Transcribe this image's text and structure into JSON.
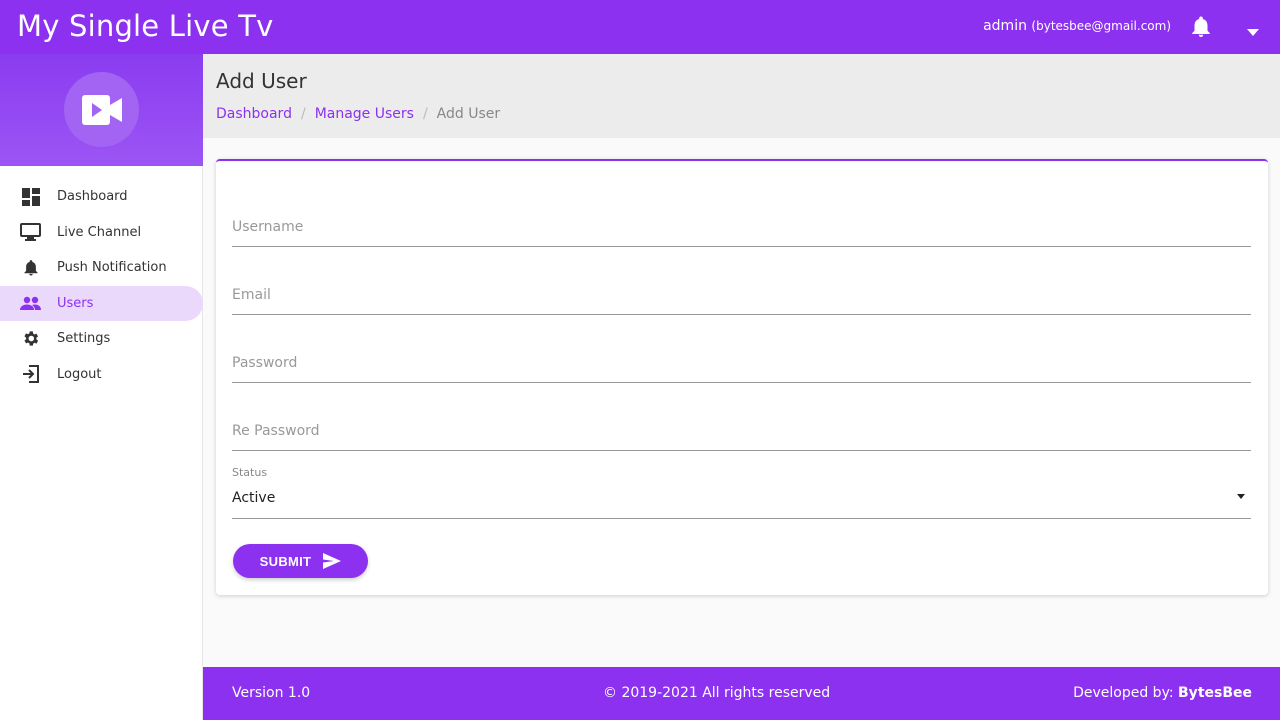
{
  "app": {
    "title": "My Single Live Tv"
  },
  "topbar": {
    "user": "admin",
    "email": "(bytesbee@gmail.com)"
  },
  "sidebar": {
    "items": [
      {
        "label": "Dashboard",
        "icon": "dashboard-icon"
      },
      {
        "label": "Live Channel",
        "icon": "monitor-icon"
      },
      {
        "label": "Push Notification",
        "icon": "bell-icon"
      },
      {
        "label": "Users",
        "icon": "users-icon",
        "active": true
      },
      {
        "label": "Settings",
        "icon": "gear-icon"
      },
      {
        "label": "Logout",
        "icon": "logout-icon"
      }
    ]
  },
  "page": {
    "title": "Add User",
    "breadcrumb": {
      "home": "Dashboard",
      "parent": "Manage Users",
      "current": "Add User",
      "separator": "/"
    }
  },
  "form": {
    "username_placeholder": "Username",
    "email_placeholder": "Email",
    "password_placeholder": "Password",
    "repassword_placeholder": "Re Password",
    "status_label": "Status",
    "status_value": "Active",
    "submit_label": "SUBMIT"
  },
  "footer": {
    "version": "Version 1.0",
    "copyright": "© 2019-2021 All rights reserved",
    "developed_by_prefix": "Developed by:",
    "developer": "BytesBee"
  },
  "colors": {
    "accent": "#8b31ef",
    "active_bg": "#ead9fb",
    "header_band": "#ececec"
  }
}
